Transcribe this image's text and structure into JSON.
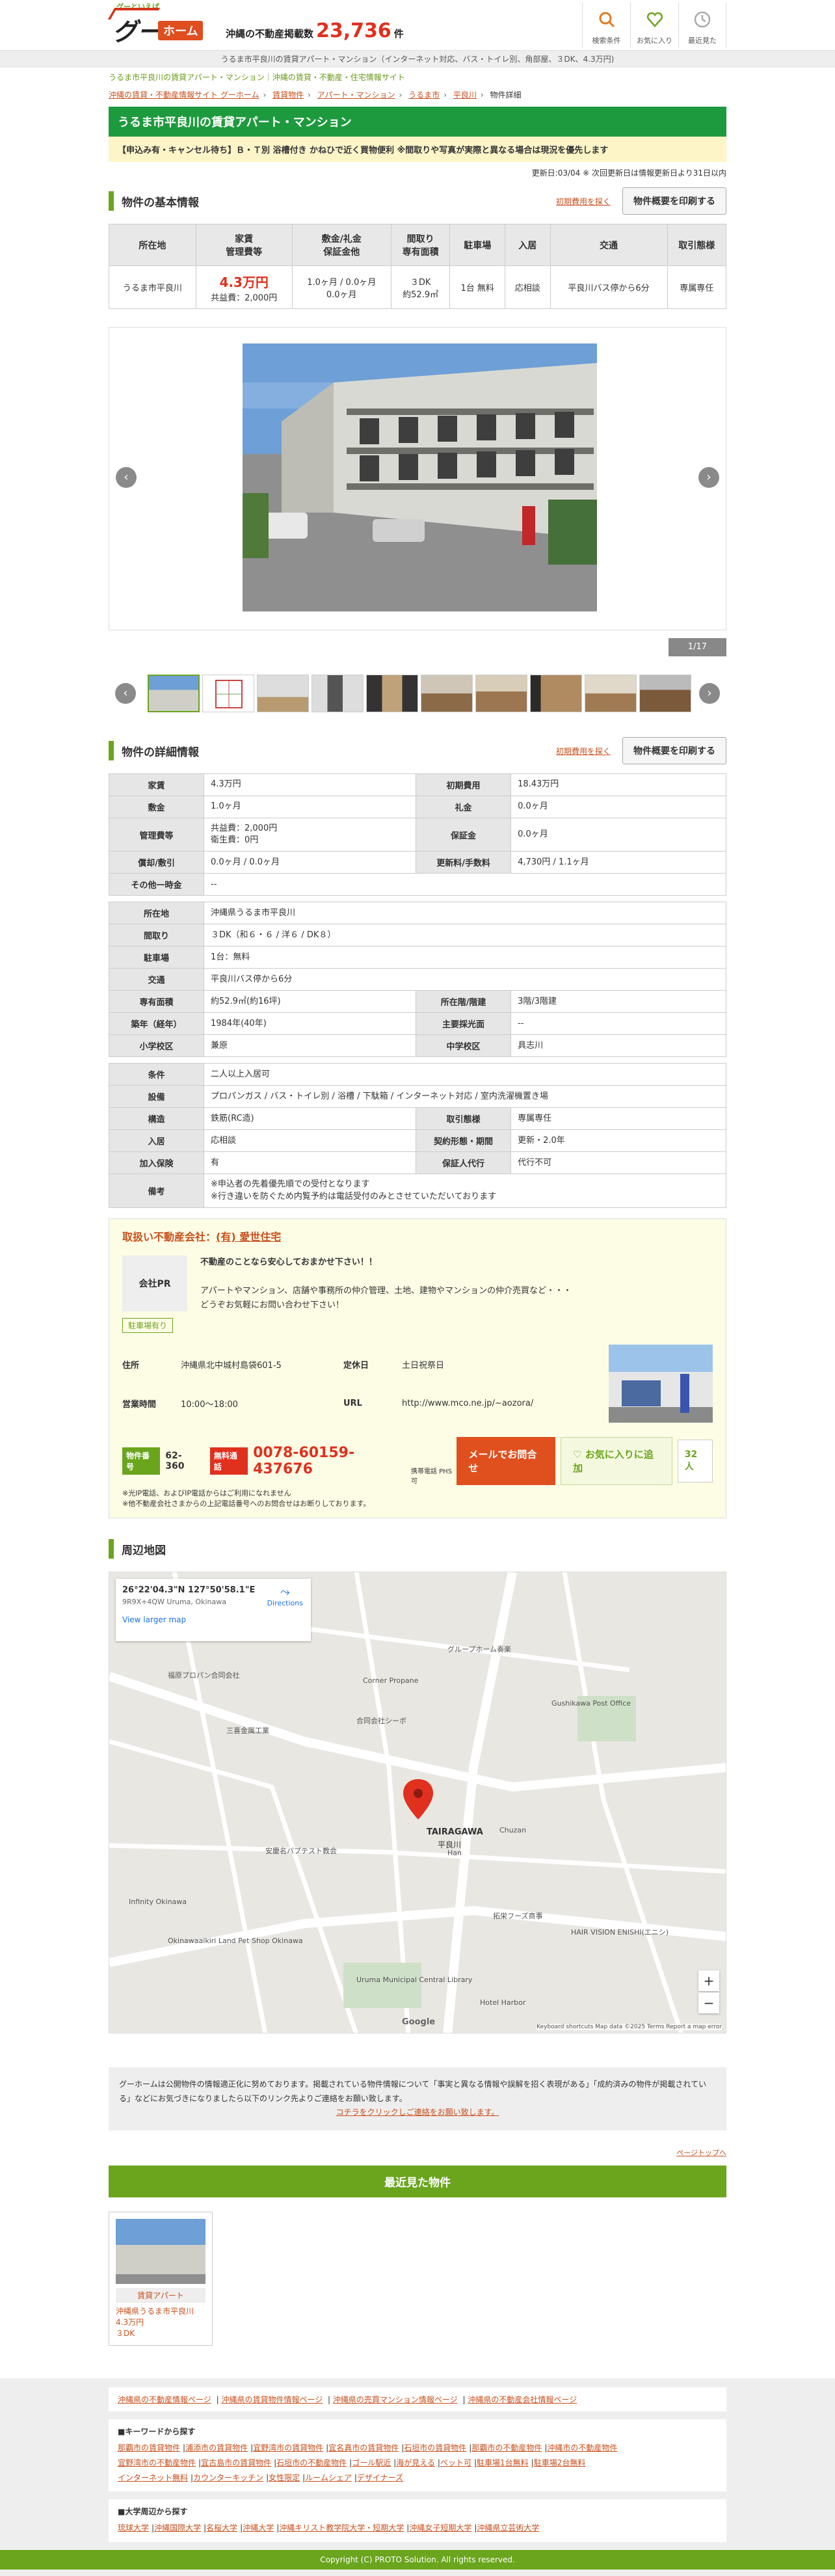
{
  "header": {
    "tagline": "グーといえば",
    "logo_gu": "グー",
    "logo_home": "ホーム",
    "count_label": "沖縄の不動産掲載数",
    "count_value": "23,736",
    "count_unit": "件",
    "nav": [
      {
        "label": "検索条件",
        "icon": "search-icon"
      },
      {
        "label": "お気に入り",
        "icon": "heart-icon"
      },
      {
        "label": "最近見た",
        "icon": "clock-icon"
      }
    ]
  },
  "subhead": "うるま市平良川の賃貸アパート・マンション（インターネット対応、バス・トイレ別、角部屋、３DK、4.3万円)",
  "catch": "うるま市平良川の賃貸アパート・マンション｜沖縄の賃貸・不動産・住宅情報サイト",
  "breadcrumb": [
    "沖縄の賃貸・不動産情報サイト グーホーム",
    "賃貸物件",
    "アパート・マンション",
    "うるま市",
    "平良川",
    "物件詳細"
  ],
  "title": "うるま市平良川の賃貸アパート・マンション",
  "notice": "【申込み有・キャンセル待ち】Ｂ・Ｔ別 浴槽付き かねひで近く買物便利 ※間取りや写真が実際と異なる場合は現況を優先します",
  "update": "更新日:03/04 ※ 次回更新日は情報更新日より31日以内",
  "basic_section": {
    "title": "物件の基本情報",
    "help_link": "初期費用を探く",
    "print": "物件概要を印刷する",
    "headers": [
      "所在地",
      "家賃\n管理費等",
      "敷金/礼金\n保証金他",
      "間取り\n専有面積",
      "駐車場",
      "入居",
      "交通",
      "取引態様"
    ],
    "row": {
      "address": "うるま市平良川",
      "rent": "4.3万円",
      "fee": "共益費：2,000円",
      "deposit": "1.0ヶ月 / 0.0ヶ月",
      "deposit2": "0.0ヶ月",
      "layout": "３DK",
      "area": "約52.9㎡",
      "parking": "1台 無料",
      "move": "応相談",
      "access": "平良川バス停から6分",
      "deal": "専属専任"
    }
  },
  "gallery": {
    "counter": "1/17",
    "prev": "‹",
    "next": "›"
  },
  "detail_section": {
    "title": "物件の詳細情報",
    "help_link": "初期費用を探く",
    "print": "物件概要を印刷する"
  },
  "detail": {
    "rent_l": "家賃",
    "rent_v": "4.3万円",
    "init_l": "初期費用",
    "init_v": "18.43万円",
    "dep_l": "敷金",
    "dep_v": "1.0ヶ月",
    "key_l": "礼金",
    "key_v": "0.0ヶ月",
    "mng_l": "管理費等",
    "mng_v1": "共益費：2,000円",
    "mng_v2": "衛生費：0円",
    "grt_l": "保証金",
    "grt_v": "0.0ヶ月",
    "back_l": "償却/敷引",
    "back_v": "0.0ヶ月 / 0.0ヶ月",
    "renew_l": "更新料/手数料",
    "renew_v": "4,730円 / 1.1ヶ月",
    "other_l": "その他一時金",
    "other_v": "--",
    "addr_l": "所在地",
    "addr_v": "沖縄県うるま市平良川",
    "lay_l": "間取り",
    "lay_v": "３DK（和６・６ / 洋６ / DK８）",
    "park_l": "駐車場",
    "park_v": "1台：無料",
    "acc_l": "交通",
    "acc_v": "平良川バス停から6分",
    "area_l": "専有面積",
    "area_v": "約52.9㎡(約16坪)",
    "floor_l": "所在階/階建",
    "floor_v": "3階/3階建",
    "built_l": "築年（経年）",
    "built_v": "1984年(40年)",
    "light_l": "主要採光面",
    "light_v": "--",
    "esch_l": "小学校区",
    "esch_v": "兼原",
    "jsch_l": "中学校区",
    "jsch_v": "具志川",
    "cond_l": "条件",
    "cond_v": "二人以上入居可",
    "eq_l": "設備",
    "eq_v": "プロパンガス / バス・トイレ別 / 浴槽 / 下駄箱 / インターネット対応 / 室内洗濯機置き場",
    "str_l": "構造",
    "str_v": "鉄筋(RC造)",
    "deal_l": "取引態様",
    "deal_v": "専属専任",
    "mv_l": "入居",
    "mv_v": "応相談",
    "ct_l": "契約形態・期間",
    "ct_v": "更新・2.0年",
    "ins_l": "加入保険",
    "ins_v": "有",
    "gc_l": "保証人代行",
    "gc_v": "代行不可",
    "rm_l": "備考",
    "rm_v1": "※申込者の先着優先順での受付となります",
    "rm_v2": "※行き違いを防ぐため内覧予約は電話受付のみとさせていただいております"
  },
  "agent": {
    "label": "取扱い不動産会社：",
    "name": "(有) 愛世住宅",
    "pr_label": "会社PR",
    "pr1": "不動産のことなら安心しておまかせ下さい！！",
    "pr2": "アパートやマンション、店舗や事務所の仲介管理、土地、建物やマンションの仲介売買など・・・",
    "pr3": "どうぞお気軽にお問い合わせ下さい！",
    "rec": "駐車場有り",
    "addr_l": "住所",
    "addr_v": "沖縄県北中城村島袋601-5",
    "hol_l": "定休日",
    "hol_v": "土日祝祭日",
    "hrs_l": "営業時間",
    "hrs_v": "10:00～18:00",
    "url_l": "URL",
    "url_v": "http://www.mco.ne.jp/~aozora/",
    "pid_l": "物件番号",
    "pid_v": "62-360",
    "free_l": "無料通話",
    "tel": "0078-60159-437676",
    "tel_note": "携帯電話 PHS可",
    "note1": "※光IP電話、およびIP電話からはご利用になれません",
    "note2": "※他不動産会社さまからの上記電話番号へのお問合せはお断りしております。",
    "mail": "メールでお問合せ",
    "fav": "お気に入りに追加",
    "fav_n": "32人"
  },
  "map_section": {
    "title": "周辺地図",
    "coord": "26°22'04.3\"N 127°50'58.1\"E",
    "code": "9R9X+4QW Uruma, Okinawa",
    "directions": "Directions",
    "larger": "View larger map",
    "town": "TAIRAGAWA",
    "town_jp": "平良川",
    "labels": [
      "グループホーム奏楽",
      "福原プロパン合同会社",
      "Corner Propane",
      "Gushikawa Post Office",
      "三喜金属工業",
      "合同会社シーボ",
      "安慶名バプテスト教会",
      "Infinity Okinawa",
      "Okinawaaikiri Land Pet Shop Okinawa",
      "Uruma Municipal Central Library",
      "HAIR VISION ENISHI(エニシ)",
      "Hotel Harbor",
      "拓栄フーズ商事",
      "Chuzan",
      "Han"
    ],
    "footer": "Keyboard shortcuts   Map data ©2025   Terms   Report a map error",
    "google": "Google"
  },
  "disclaimer": {
    "text": "グーホームは公開物件の情報適正化に努めております。掲載されている物件情報について「事実と異なる情報や誤解を招く表現がある」「成約済みの物件が掲載されている」などにお気づきになりましたら以下のリンク先よりご連絡をお願い致します。",
    "link": "コチラをクリックしご連絡をお願い致します。",
    "pagetop": "ページトップへ"
  },
  "recent": {
    "title": "最近見た物件",
    "card_type": "賃貸アパート",
    "card_name": "沖縄県うるま市平良川",
    "card_price": "4.3万円",
    "card_layout": "３DK"
  },
  "footer": {
    "links_top": [
      "沖縄県の不動産情報ページ",
      "沖縄県の賃貸物件情報ページ",
      "沖縄県の売買マンション情報ページ",
      "沖縄県の不動産会社情報ページ"
    ],
    "kw_title": "■キーワードから探す",
    "kw1": [
      "那覇市の賃貸物件",
      "浦添市の賃貸物件",
      "宜野湾市の賃貸物件",
      "宜名真市の賃貸物件",
      "石垣市の賃貸物件",
      "那覇市の不動産物件",
      "沖縄市の不動産物件"
    ],
    "kw2": [
      "宜野湾市の不動産物件",
      "宜古島市の賃貸物件",
      "石垣市の不動産物件",
      "ゴール駅近",
      "海が見える",
      "ペット可",
      "駐車場1台無料",
      "駐車場2台無料"
    ],
    "kw3": [
      "インターネット無料",
      "カウンターキッチン",
      "女性限定",
      "ルームシェア",
      "デザイナーズ"
    ],
    "uni_title": "■大学周辺から探す",
    "uni": [
      "琉球大学",
      "沖縄国際大学",
      "名桜大学",
      "沖縄大学",
      "沖縄キリスト教学院大学・短期大学",
      "沖縄女子短期大学",
      "沖縄県立芸術大学"
    ],
    "copy": "Copyright (C) PROTO Solution. All rights reserved."
  }
}
